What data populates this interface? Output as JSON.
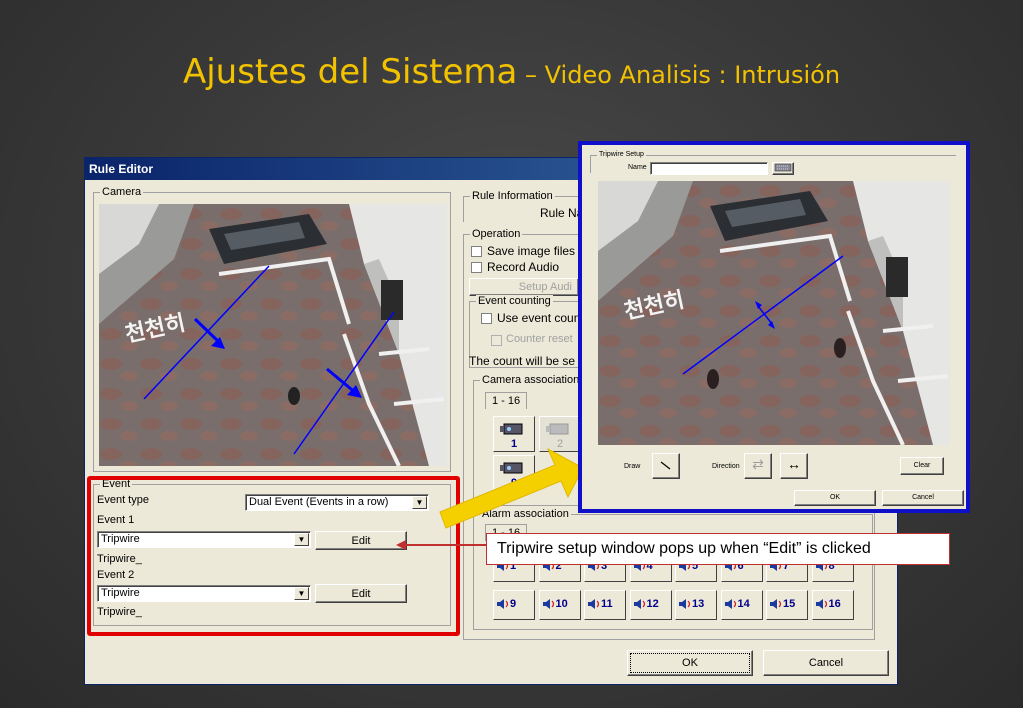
{
  "slide": {
    "title_main": "Ajustes del Sistema",
    "title_sub": " – Video Analisis : Intrusión"
  },
  "rule_editor": {
    "title": "Rule Editor",
    "camera_group": "Camera",
    "event_group": "Event",
    "event_type_label": "Event type",
    "event_type_value": "Dual Event (Events in a row)",
    "event1_label": "Event 1",
    "event1_value": "Tripwire",
    "event1_edit": "Edit",
    "event1_caption": "Tripwire_",
    "event2_label": "Event 2",
    "event2_value": "Tripwire",
    "event2_edit": "Edit",
    "event2_caption": "Tripwire_",
    "rule_info_group": "Rule Information",
    "rule_name_label": "Rule Na",
    "operation_group": "Operation",
    "save_image_files": "Save image files",
    "record_audio": "Record Audio",
    "setup_audio": "Setup Audi",
    "event_counting_group": "Event counting",
    "use_event_counting": "Use event counti",
    "counter_reset": "Counter reset",
    "count_will_be": "The count will be se",
    "camera_assoc_group": "Camera association",
    "camera_tab": "1 - 16",
    "camera_buttons": [
      "1",
      "2",
      "9"
    ],
    "alarm_assoc_group": "Alarm association",
    "alarm_tab": "1 - 16",
    "alarm_row1": [
      "1",
      "2",
      "3",
      "4",
      "5",
      "6",
      "7",
      "8"
    ],
    "alarm_row2": [
      "9",
      "10",
      "11",
      "12",
      "13",
      "14",
      "15",
      "16"
    ],
    "ok": "OK",
    "cancel": "Cancel"
  },
  "tripwire": {
    "group": "Tripwire Setup",
    "name_label": "Name",
    "name_value": "",
    "draw_label": "Draw",
    "direction_label": "Direction",
    "clear": "Clear",
    "ok": "OK",
    "cancel": "Cancel"
  },
  "callout": {
    "text": "Tripwire setup window pops up when “Edit” is clicked"
  },
  "camera_scene": {
    "korean_text": "천천히"
  },
  "colors": {
    "title": "#f2c200",
    "highlight_box": "#e00000",
    "tripwire_border": "#1010c8",
    "tripwire_line": "#0000ff",
    "arrow": "#f5d000"
  }
}
